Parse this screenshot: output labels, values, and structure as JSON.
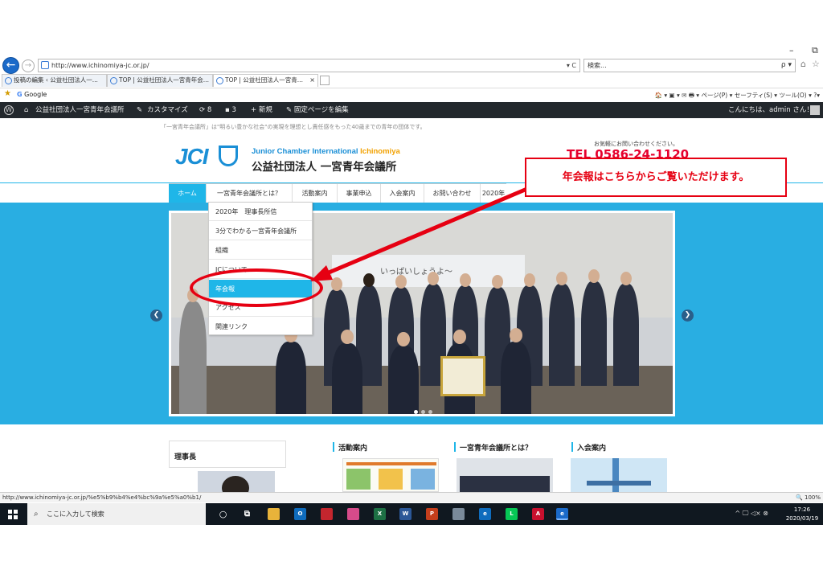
{
  "browser": {
    "url": "http://www.ichinomiya-jc.or.jp/",
    "url_tools": "▾ C",
    "search_placeholder": "検索...",
    "search_tools": "ρ ▾",
    "tabs": [
      {
        "label": "投稿の編集 ‹ 公益社団法人一..."
      },
      {
        "label": "TOP | 公益社団法人一宮青年会..."
      },
      {
        "label": "TOP | 公益社団法人一宮青..."
      }
    ],
    "favorites": [
      "Google"
    ],
    "command_bar": "🏠 ▾  ▣ ▾  ✉  🖶 ▾  ページ(P) ▾  セーフティ(S) ▾  ツール(O) ▾  ?▾"
  },
  "wp_admin": {
    "site_name": "公益社団法人一宮青年会議所",
    "customize": "カスタマイズ",
    "updates": "8",
    "comments": "3",
    "new": "新規",
    "edit_page": "固定ページを編集",
    "greeting": "こんにちは、admin さん！"
  },
  "site": {
    "tagline": "「一宮青年会議所」は\"明るい豊かな社会\"の実現を理想とし責任感をもった40歳までの青年の団体です。",
    "logo_jci": "JCI",
    "logo_en_1": "Junior Chamber International",
    "logo_en_2": "Ichinomiya",
    "logo_ja": "公益社団法人 一宮青年会議所",
    "contact_note": "お気軽にお問い合わせください。",
    "phone": "TEL 0586-24-1120",
    "nav": [
      "ホーム",
      "一宮青年会議所とは？",
      "活動案内",
      "事業申込",
      "入会案内",
      "お問い合わせ",
      "2020年"
    ],
    "dropdown": [
      "2020年　理事長所信",
      "3分でわかる一宮青年会議所",
      "組織",
      "JCについて",
      "年会報",
      "アクセス",
      "関連リンク"
    ],
    "hero_banner": "いっぱいしょうよ〜",
    "sections": [
      {
        "title": "理事長"
      },
      {
        "title": "活動案内"
      },
      {
        "title": "一宮青年会議所とは？"
      },
      {
        "title": "入会案内"
      }
    ]
  },
  "annotation": {
    "callout": "年会報はこちらからご覧いただけます。",
    "color": "#e60012"
  },
  "status": {
    "link": "http://www.ichinomiya-jc.or.jp/%e5%b9%b4%e4%bc%9a%e5%a0%b1/",
    "zoom": "100%"
  },
  "taskbar": {
    "search_placeholder": "ここに入力して検索",
    "tray": "^ 🖵 ◁× ⊗",
    "time": "17:26",
    "date": "2020/03/19"
  }
}
